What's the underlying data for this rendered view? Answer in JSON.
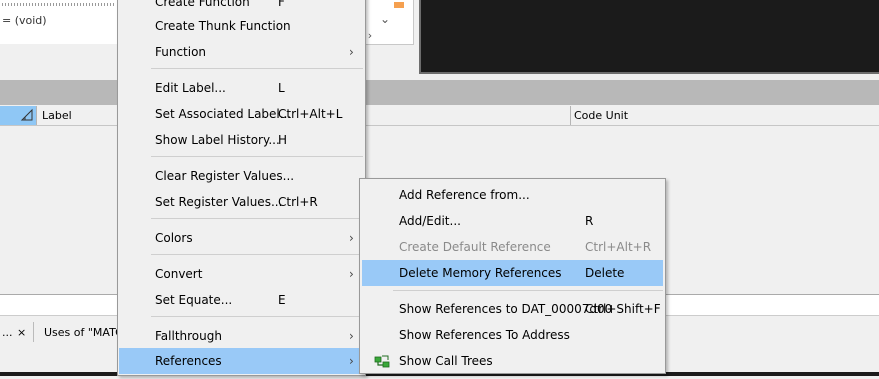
{
  "listing": {
    "code_fragment": "= (void)"
  },
  "scroll": {
    "down_glyph": "⌄",
    "right_glyph": "›"
  },
  "table": {
    "columns": [
      {
        "label": "Label"
      },
      {
        "label": "Code Unit"
      }
    ]
  },
  "bottom_tabs": [
    {
      "label": "...",
      "close": "×"
    },
    {
      "label": "Uses of \"MATC"
    }
  ],
  "main_menu": {
    "items": [
      {
        "label": "Create Function",
        "accel": "F"
      },
      {
        "label": "Create Thunk Function",
        "accel": ""
      },
      {
        "label": "Function",
        "submenu": "›"
      },
      {
        "label": "Edit Label...",
        "accel": "L"
      },
      {
        "label": "Set Associated Label...",
        "accel": "Ctrl+Alt+L"
      },
      {
        "label": "Show Label History...",
        "accel": "H"
      },
      {
        "label": "Clear Register Values...",
        "accel": ""
      },
      {
        "label": "Set Register Values...",
        "accel": "Ctrl+R"
      },
      {
        "label": "Colors",
        "submenu": "›"
      },
      {
        "label": "Convert",
        "submenu": "›"
      },
      {
        "label": "Set Equate...",
        "accel": "E"
      },
      {
        "label": "Fallthrough",
        "submenu": "›"
      },
      {
        "label": "References",
        "submenu": "›",
        "highlighted": true
      }
    ]
  },
  "references_menu": {
    "items": [
      {
        "label": "Add Reference from...",
        "accel": ""
      },
      {
        "label": "Add/Edit...",
        "accel": "R"
      },
      {
        "label": "Create Default Reference",
        "accel": "Ctrl+Alt+R",
        "disabled": true
      },
      {
        "label": "Delete Memory References",
        "accel": "Delete",
        "highlighted": true
      },
      {
        "label": "Show References to DAT_00007d00",
        "accel": "Ctrl+Shift+F"
      },
      {
        "label": "Show References To Address",
        "accel": ""
      },
      {
        "label": "Show Call Trees",
        "accel": "",
        "icon": "call-tree-icon"
      }
    ]
  },
  "colors": {
    "highlight": "#99c9f7",
    "console_bg": "#1b1b1b",
    "menu_bg": "#f0f0f0",
    "accent_orange": "#f5a050",
    "call_tree_green": "#3aa83a"
  }
}
